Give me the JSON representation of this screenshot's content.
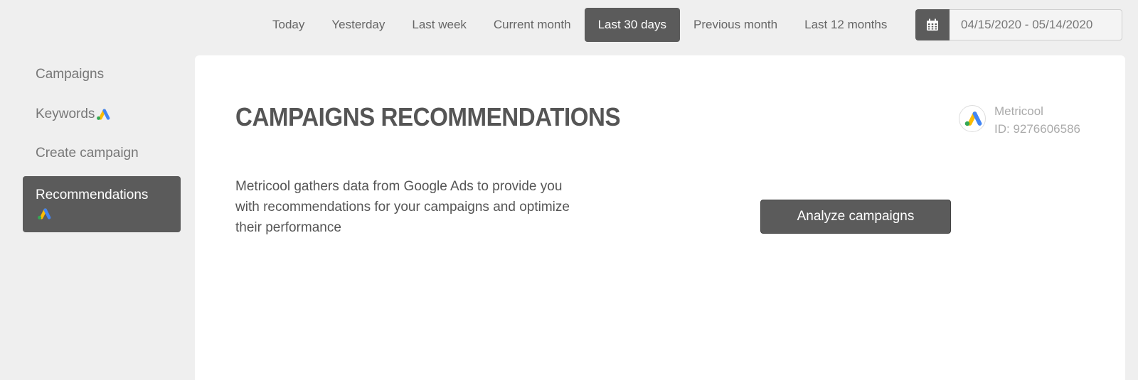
{
  "date_range": {
    "options": [
      {
        "label": "Today",
        "active": false
      },
      {
        "label": "Yesterday",
        "active": false
      },
      {
        "label": "Last week",
        "active": false
      },
      {
        "label": "Current month",
        "active": false
      },
      {
        "label": "Last 30 days",
        "active": true
      },
      {
        "label": "Previous month",
        "active": false
      },
      {
        "label": "Last 12 months",
        "active": false
      }
    ],
    "calendar_icon": "calendar-icon",
    "value": "04/15/2020 - 05/14/2020"
  },
  "sidebar": {
    "items": [
      {
        "label": "Campaigns",
        "icon": null,
        "active": false
      },
      {
        "label": "Keywords",
        "icon": "google-ads-icon",
        "active": false
      },
      {
        "label": "Create campaign",
        "icon": null,
        "active": false
      },
      {
        "label": "Recommendations",
        "icon": "google-ads-icon",
        "active": true
      }
    ]
  },
  "main": {
    "title": "CAMPAIGNS RECOMMENDATIONS",
    "account": {
      "name": "Metricool",
      "id": "ID: 9276606586",
      "icon": "google-ads-icon"
    },
    "description": "Metricool gathers data from Google Ads to provide you with recommendations for your campaigns and optimize their performance",
    "analyze_label": "Analyze campaigns"
  },
  "colors": {
    "accent": "#5b5b5b",
    "background": "#efefef",
    "gads_blue": "#4285f4",
    "gads_yellow": "#fbbc04",
    "gads_green": "#34a853"
  }
}
